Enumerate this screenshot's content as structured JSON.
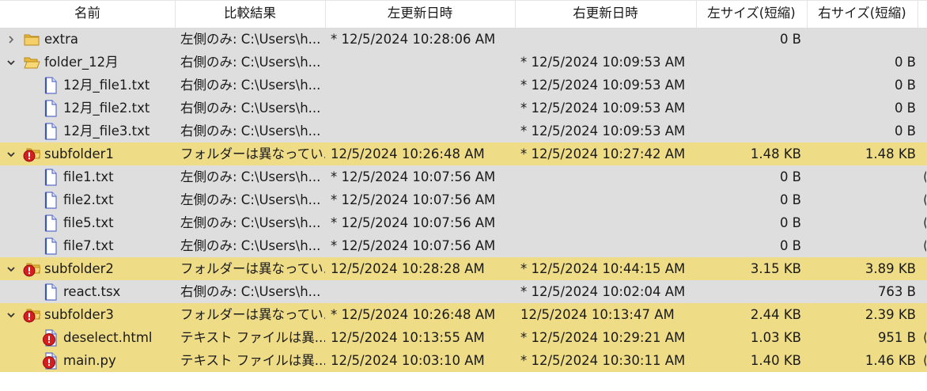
{
  "columns": {
    "name": "名前",
    "result": "比較結果",
    "left_date": "左更新日時",
    "right_date": "右更新日時",
    "left_size": "左サイズ(短縮)",
    "right_size": "右サイズ(短縮)"
  },
  "colors": {
    "row_gray": "#dedede",
    "row_diff": "#efdc87"
  },
  "rows": [
    {
      "name": "extra",
      "result": "左側のみ: C:\\Users\\h...",
      "left_date": "* 12/5/2024 10:28:06 AM",
      "right_date": "",
      "left_size": "0 B",
      "right_size": "",
      "level": 0,
      "icon": "folder-icon",
      "expander": "chevron-right-icon",
      "diff": false,
      "edge": ""
    },
    {
      "name": "folder_12月",
      "result": "右側のみ: C:\\Users\\h...",
      "left_date": "",
      "right_date": "* 12/5/2024 10:09:53 AM",
      "left_size": "",
      "right_size": "0 B",
      "level": 0,
      "icon": "folder-open-icon",
      "expander": "chevron-down-icon",
      "diff": false,
      "edge": ""
    },
    {
      "name": "12月_file1.txt",
      "result": "右側のみ: C:\\Users\\h...",
      "left_date": "",
      "right_date": "* 12/5/2024 10:09:53 AM",
      "left_size": "",
      "right_size": "0 B",
      "level": 1,
      "icon": "file-icon",
      "expander": "",
      "diff": false,
      "edge": ""
    },
    {
      "name": "12月_file2.txt",
      "result": "右側のみ: C:\\Users\\h...",
      "left_date": "",
      "right_date": "* 12/5/2024 10:09:53 AM",
      "left_size": "",
      "right_size": "0 B",
      "level": 1,
      "icon": "file-icon",
      "expander": "",
      "diff": false,
      "edge": ""
    },
    {
      "name": "12月_file3.txt",
      "result": "右側のみ: C:\\Users\\h...",
      "left_date": "",
      "right_date": "* 12/5/2024 10:09:53 AM",
      "left_size": "",
      "right_size": "0 B",
      "level": 1,
      "icon": "file-icon",
      "expander": "",
      "diff": false,
      "edge": ""
    },
    {
      "name": "subfolder1",
      "result": "フォルダーは異なってい...",
      "left_date": "12/5/2024 10:26:48 AM",
      "right_date": "* 12/5/2024 10:27:42 AM",
      "left_size": "1.48 KB",
      "right_size": "1.48 KB",
      "level": 0,
      "icon": "folder-diff-icon",
      "expander": "chevron-down-icon",
      "diff": true,
      "edge": ""
    },
    {
      "name": "file1.txt",
      "result": "左側のみ: C:\\Users\\h...",
      "left_date": "* 12/5/2024 10:07:56 AM",
      "right_date": "",
      "left_size": "0 B",
      "right_size": "",
      "level": 1,
      "icon": "file-icon",
      "expander": "",
      "diff": false,
      "edge": "("
    },
    {
      "name": "file2.txt",
      "result": "左側のみ: C:\\Users\\h...",
      "left_date": "* 12/5/2024 10:07:56 AM",
      "right_date": "",
      "left_size": "0 B",
      "right_size": "",
      "level": 1,
      "icon": "file-icon",
      "expander": "",
      "diff": false,
      "edge": "("
    },
    {
      "name": "file5.txt",
      "result": "左側のみ: C:\\Users\\h...",
      "left_date": "* 12/5/2024 10:07:56 AM",
      "right_date": "",
      "left_size": "0 B",
      "right_size": "",
      "level": 1,
      "icon": "file-icon",
      "expander": "",
      "diff": false,
      "edge": "("
    },
    {
      "name": "file7.txt",
      "result": "左側のみ: C:\\Users\\h...",
      "left_date": "* 12/5/2024 10:07:56 AM",
      "right_date": "",
      "left_size": "0 B",
      "right_size": "",
      "level": 1,
      "icon": "file-icon",
      "expander": "",
      "diff": false,
      "edge": "("
    },
    {
      "name": "subfolder2",
      "result": "フォルダーは異なってい...",
      "left_date": "12/5/2024 10:28:28 AM",
      "right_date": "* 12/5/2024 10:44:15 AM",
      "left_size": "3.15 KB",
      "right_size": "3.89 KB",
      "level": 0,
      "icon": "folder-diff-icon",
      "expander": "chevron-down-icon",
      "diff": true,
      "edge": ""
    },
    {
      "name": "react.tsx",
      "result": "右側のみ: C:\\Users\\h...",
      "left_date": "",
      "right_date": "* 12/5/2024 10:02:04 AM",
      "left_size": "",
      "right_size": "763 B",
      "level": 1,
      "icon": "file-icon",
      "expander": "",
      "diff": false,
      "edge": ""
    },
    {
      "name": "subfolder3",
      "result": "フォルダーは異なってい...",
      "left_date": "* 12/5/2024 10:26:48 AM",
      "right_date": "12/5/2024 10:13:47 AM",
      "left_size": "2.44 KB",
      "right_size": "2.39 KB",
      "level": 0,
      "icon": "folder-diff-icon",
      "expander": "chevron-down-icon",
      "diff": true,
      "edge": ""
    },
    {
      "name": "deselect.html",
      "result": "テキスト ファイルは異...",
      "left_date": "12/5/2024 10:13:55 AM",
      "right_date": "* 12/5/2024 10:29:21 AM",
      "left_size": "1.03 KB",
      "right_size": "951 B",
      "level": 1,
      "icon": "file-diff-icon",
      "expander": "",
      "diff": true,
      "edge": "("
    },
    {
      "name": "main.py",
      "result": "テキスト ファイルは異...",
      "left_date": "12/5/2024 10:03:10 AM",
      "right_date": "* 12/5/2024 10:30:11 AM",
      "left_size": "1.40 KB",
      "right_size": "1.46 KB",
      "level": 1,
      "icon": "file-diff-icon",
      "expander": "",
      "diff": true,
      "edge": "("
    }
  ]
}
